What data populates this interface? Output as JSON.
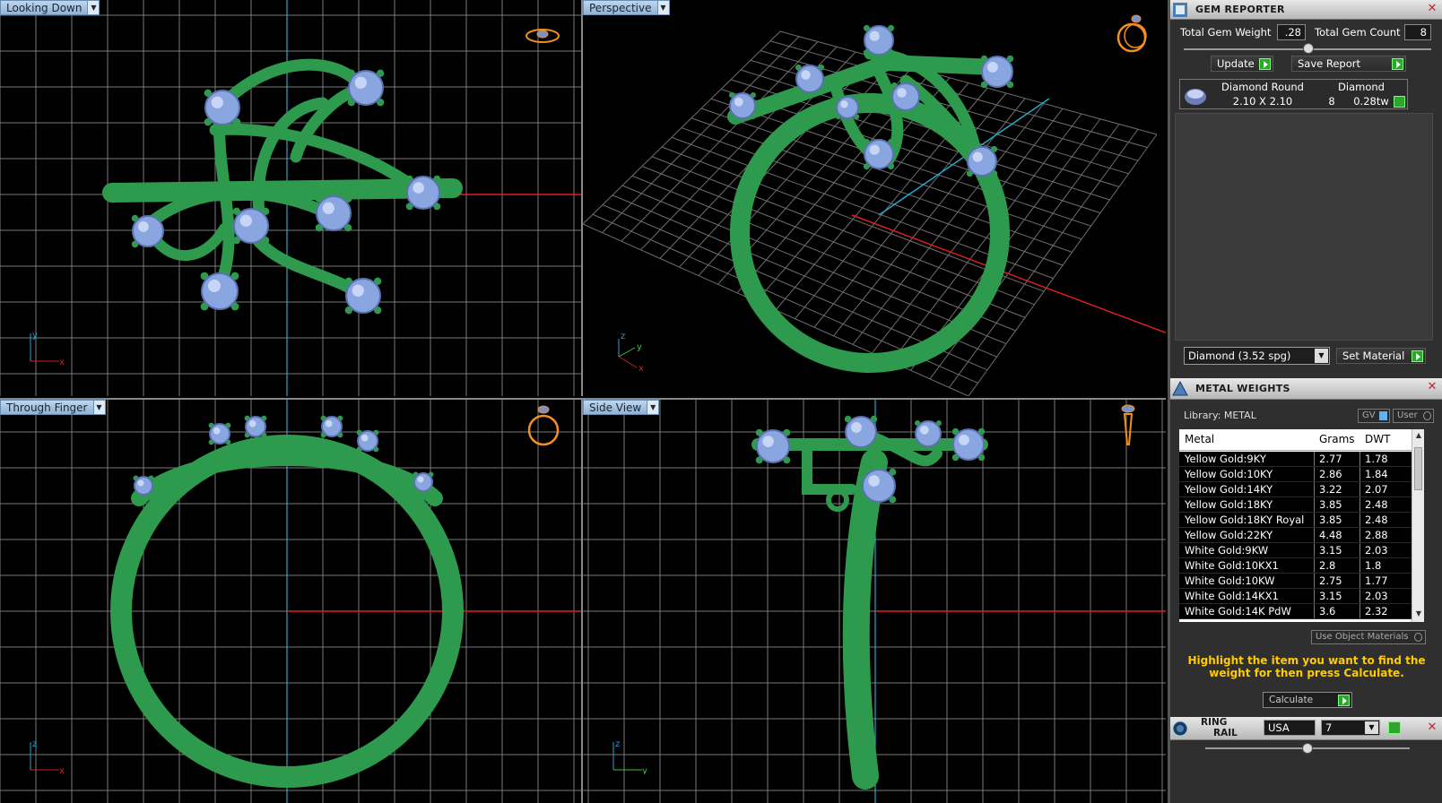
{
  "viewports": {
    "top": {
      "label": "Looking Down"
    },
    "perspective": {
      "label": "Perspective"
    },
    "front": {
      "label": "Through Finger"
    },
    "side": {
      "label": "Side View"
    }
  },
  "axes": {
    "top": {
      "v": "y",
      "h": "x"
    },
    "perspective": {
      "v": "z",
      "a": "y",
      "h": "x"
    },
    "front": {
      "v": "z",
      "h": "x"
    },
    "side": {
      "v": "z",
      "h": "y"
    }
  },
  "gem_reporter": {
    "title": "GEM REPORTER",
    "total_weight_label": "Total Gem Weight",
    "total_weight_value": ".28",
    "total_count_label": "Total Gem Count",
    "total_count_value": "8",
    "update_label": "Update",
    "save_report_label": "Save Report",
    "gem_row": {
      "shape": "Diamond Round",
      "size": "2.10 X 2.10",
      "material": "Diamond",
      "count": "8",
      "weight": "0.28tw"
    },
    "material_select": "Diamond    (3.52 spg)",
    "set_material_label": "Set Material"
  },
  "metal_weights": {
    "title": "METAL WEIGHTS",
    "library_label": "Library: METAL",
    "gv_label": "GV",
    "user_label": "User",
    "columns": [
      "Metal",
      "Grams",
      "DWT"
    ],
    "rows": [
      [
        "Yellow Gold:9KY",
        "2.77",
        "1.78"
      ],
      [
        "Yellow Gold:10KY",
        "2.86",
        "1.84"
      ],
      [
        "Yellow Gold:14KY",
        "3.22",
        "2.07"
      ],
      [
        "Yellow Gold:18KY",
        "3.85",
        "2.48"
      ],
      [
        "Yellow Gold:18KY Royal",
        "3.85",
        "2.48"
      ],
      [
        "Yellow Gold:22KY",
        "4.48",
        "2.88"
      ],
      [
        "White Gold:9KW",
        "3.15",
        "2.03"
      ],
      [
        "White Gold:10KX1",
        "2.8",
        "1.8"
      ],
      [
        "White Gold:10KW",
        "2.75",
        "1.77"
      ],
      [
        "White Gold:14KX1",
        "3.15",
        "2.03"
      ],
      [
        "White Gold:14K PdW",
        "3.6",
        "2.32"
      ]
    ],
    "use_object_materials_label": "Use Object Materials",
    "hint": "Highlight the item you want to find the weight for then press Calculate.",
    "calculate_label": "Calculate"
  },
  "ring_rail": {
    "title_line1": "RING",
    "title_line2": "RAIL",
    "country": "USA",
    "size": "7"
  },
  "colors": {
    "metal_green": "#2e9a4e",
    "gem_blue": "#8aa6e0",
    "grid": "#7a7a7a",
    "axis_red": "#e02020",
    "axis_cyan": "#28a8c8",
    "hint_yellow": "#ffcc00",
    "go_green": "#2ea52e"
  }
}
